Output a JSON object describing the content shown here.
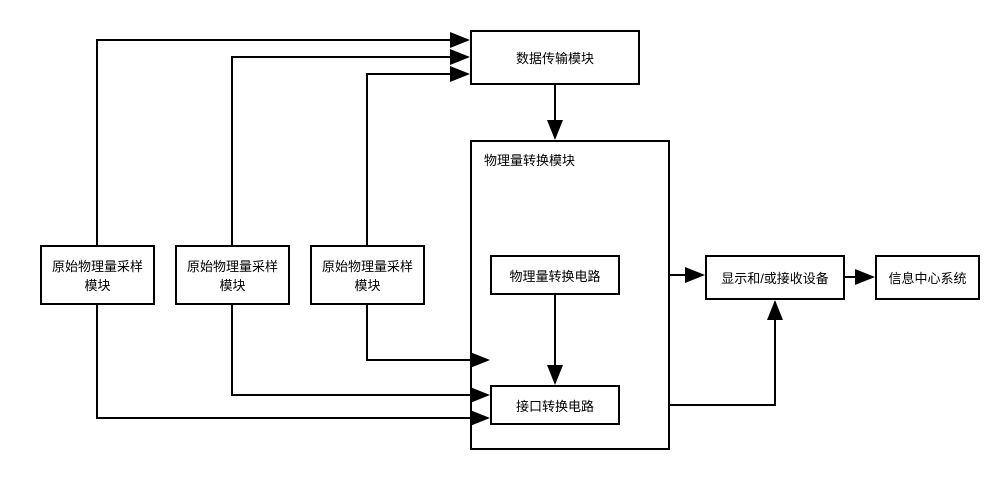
{
  "boxes": {
    "sampleA": "原始物理量采样模块",
    "sampleB": "原始物理量采样模块",
    "sampleC": "原始物理量采样模块",
    "dataTrans": "数据传输模块",
    "physConvContainer": "物理量转换模块",
    "physConvCircuit": "物理量转换电路",
    "ifaceCircuit": "接口转换电路",
    "display": "显示和/或接收设备",
    "infoCenter": "信息中心系统"
  }
}
